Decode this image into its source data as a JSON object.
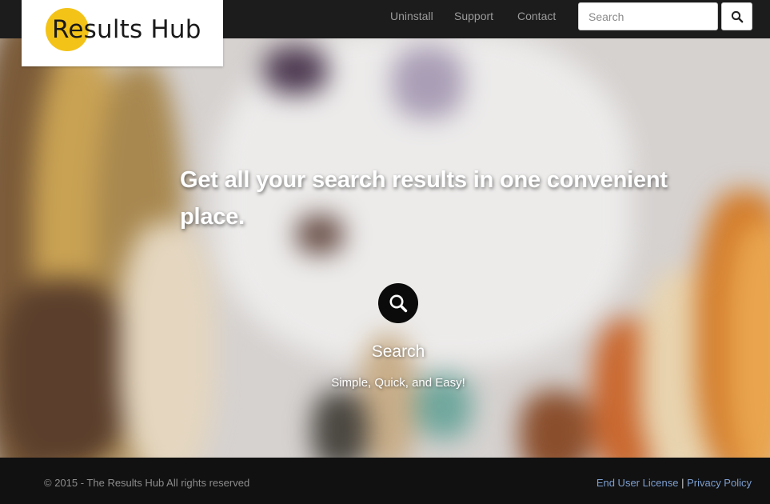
{
  "brand": {
    "name": "Results Hub",
    "accent": "#f3c318"
  },
  "header": {
    "nav": [
      {
        "label": "Uninstall"
      },
      {
        "label": "Support"
      },
      {
        "label": "Contact"
      }
    ],
    "search": {
      "placeholder": "Search",
      "button_icon": "search-icon"
    }
  },
  "hero": {
    "headline": "Get all your search results in one convenient place.",
    "icon": "search-icon",
    "title": "Search",
    "subtitle": "Simple, Quick, and Easy!"
  },
  "footer": {
    "copyright": "© 2015 - The Results Hub All rights reserved",
    "links": [
      {
        "label": "End User License"
      },
      {
        "label": "Privacy Policy"
      }
    ],
    "separator": "|"
  }
}
